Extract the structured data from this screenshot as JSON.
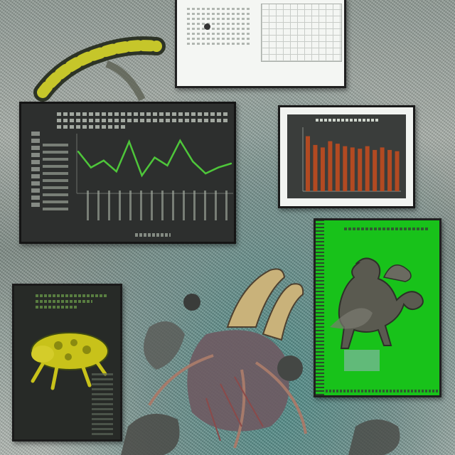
{
  "scene": {
    "boards": [
      {
        "id": "top-whiteboard",
        "kind": "screen"
      },
      {
        "id": "line-chart-board",
        "kind": "chart"
      },
      {
        "id": "bar-chart-board",
        "kind": "chart"
      },
      {
        "id": "green-board",
        "kind": "poster"
      },
      {
        "id": "dark-poster",
        "kind": "poster"
      }
    ]
  },
  "line_chart": {
    "type": "line",
    "values": [
      42,
      26,
      33,
      22,
      52,
      18,
      36,
      28,
      53,
      32,
      20,
      26,
      30
    ],
    "ylim": [
      0,
      60
    ],
    "color": "#4ec63a"
  },
  "bar_chart": {
    "type": "bar",
    "values": [
      88,
      74,
      70,
      80,
      76,
      72,
      70,
      68,
      72,
      66,
      70,
      66,
      64
    ],
    "ylim": [
      0,
      100
    ],
    "color": "#b24a22"
  },
  "colors": {
    "green_board": "#18c21a",
    "dark_panel": "#2d2f2e",
    "frog_yellow": "#c8c21a",
    "caterpillar_yellow": "#c6c62a"
  },
  "icons": [
    "caterpillar-art",
    "frog-art",
    "dragon-art",
    "tentacle-creature-art",
    "stone-orb"
  ]
}
